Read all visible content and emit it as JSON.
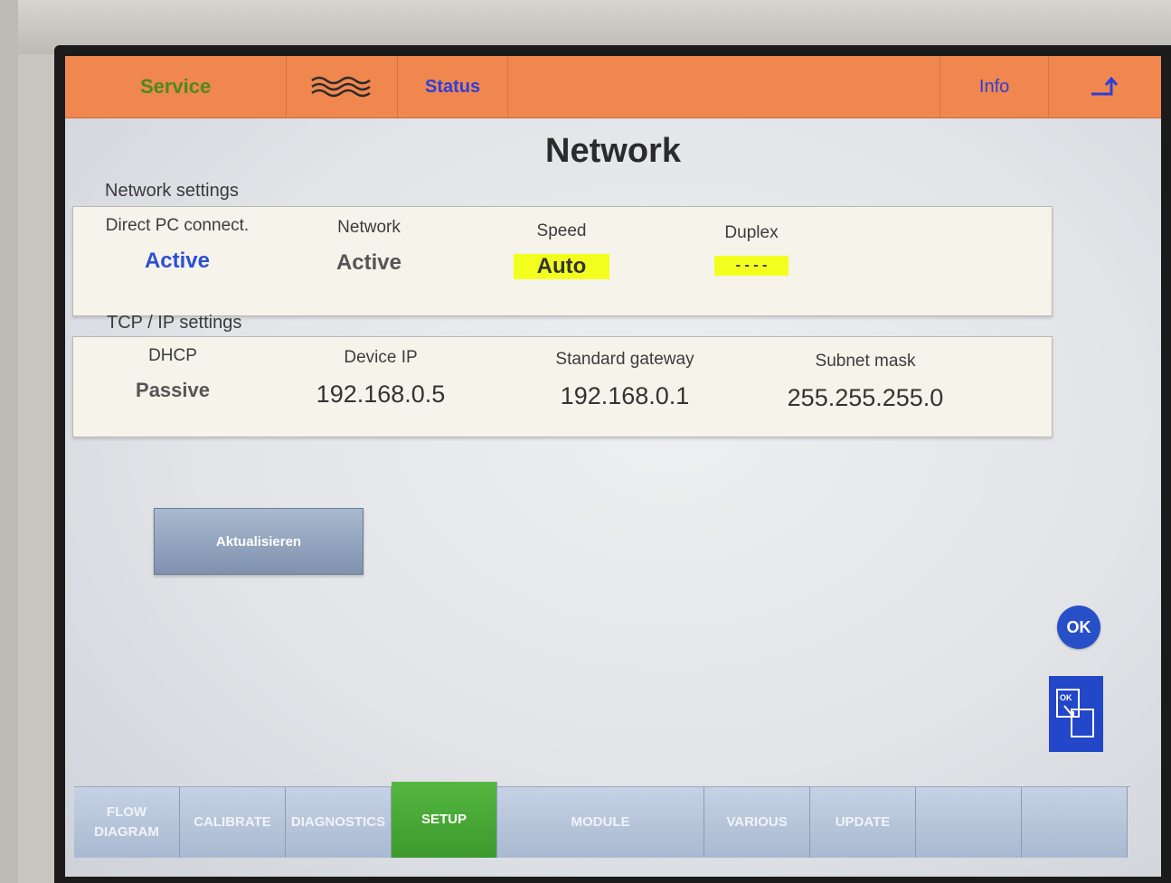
{
  "topbar": {
    "service": "Service",
    "waves_icon": "≈",
    "status": "Status",
    "info": "Info",
    "back_icon": "⤴"
  },
  "page": {
    "title": "Network"
  },
  "network_settings": {
    "label": "Network settings",
    "columns": [
      {
        "header": "Direct PC connect.",
        "value": "Active"
      },
      {
        "header": "Network",
        "value": "Active"
      },
      {
        "header": "Speed",
        "value": "Auto"
      },
      {
        "header": "Duplex",
        "value": "- - - -"
      }
    ]
  },
  "tcpip_settings": {
    "label": "TCP / IP settings",
    "columns": [
      {
        "header": "DHCP",
        "value": "Passive"
      },
      {
        "header": "Device IP",
        "value": "192.168.0.5"
      },
      {
        "header": "Standard gateway",
        "value": "192.168.0.1"
      },
      {
        "header": "Subnet mask",
        "value": "255.255.255.0"
      }
    ]
  },
  "actions": {
    "update": "Aktualisieren",
    "ok": "OK",
    "ok_swap_icon": "OK"
  },
  "bottom_tabs": [
    "FLOW DIAGRAM",
    "CALIBRATE",
    "DIAGNOSTICS",
    "SETUP",
    "MODULE",
    "VARIOUS",
    "UPDATE",
    "",
    ""
  ],
  "colors": {
    "topbar": "#f0874f",
    "active_tab": "#4caf3a",
    "highlight": "#f2ff1e",
    "accent_blue": "#2b4fd6"
  }
}
